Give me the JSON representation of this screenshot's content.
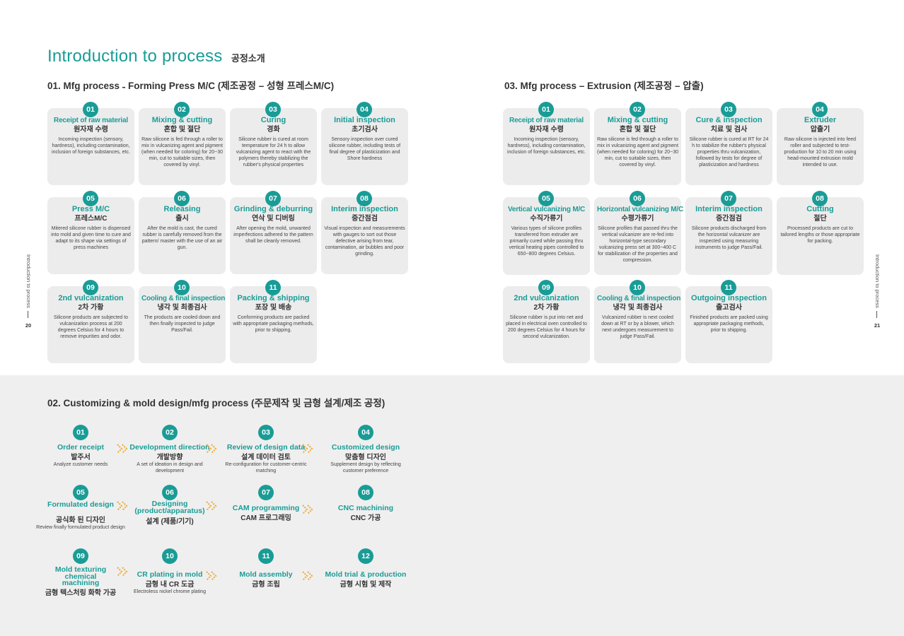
{
  "page_title": {
    "en": "Introduction to process",
    "ko": "공정소개"
  },
  "side_label": "Introduction to process",
  "page_numbers": {
    "left": "20",
    "right": "21"
  },
  "sections": {
    "forming": "01. Mfg process  ˗  Forming Press M/C  (제조공정 – 성형 프레스M/C)",
    "extrusion": "03. Mfg process – Extrusion  (제조공정 – 압출)",
    "custom": "02. Customizing & mold design/mfg process (주문제작 및 금형 설계/제조 공정)"
  },
  "forming_steps": [
    {
      "num": "01",
      "en": "Receipt of raw material",
      "ko": "원자재 수령",
      "desc": "Incoming inspection (sensory, hardness), including contamination, inclusion of foreign substances, etc."
    },
    {
      "num": "02",
      "en": "Mixing & cutting",
      "ko": "혼합 및 절단",
      "desc": "Raw silicone is fed through a roller to mix in vulcanizing agent and pigment (when needed for coloring) for 20~30 min, cut to suitable sizes, then covered by vinyl."
    },
    {
      "num": "03",
      "en": "Curing",
      "ko": "경화",
      "desc": "Silicone rubber is cured at room temperature for 24 h to allow vulcanizing agent to react with the polymers thereby stabilizing the rubber's physical properties"
    },
    {
      "num": "04",
      "en": "Initial inspection",
      "ko": "초기검사",
      "desc": "Sensory inspection over cured silicone rubber, including tests of final degree of plasticization and Shore hardness"
    },
    {
      "num": "05",
      "en": "Press M/C",
      "ko": "프레스M/C",
      "desc": "Mitered silicone rubber is dispensed into mold and given time to cure and adapt to its shape via settings of press machines"
    },
    {
      "num": "06",
      "en": "Releasing",
      "ko": "출시",
      "desc": "After the mold is cast, the cured rubber is carefully removed from the pattern/ master with the use of an air gun."
    },
    {
      "num": "07",
      "en": "Grinding & deburring",
      "ko": "연삭 및 디버링",
      "desc": "After opening the mold, unwanted imperfections adhered to the pattern shall be cleanly removed."
    },
    {
      "num": "08",
      "en": "Interim inspection",
      "ko": "중간점검",
      "desc": "Visual inspection and measurements with gauges to sort out those defective arising from tear, contamination, air bubbles and poor grinding."
    },
    {
      "num": "09",
      "en": "2nd vulcanization",
      "ko": "2차 가황",
      "desc": "Silicone products are subjected to vulcanization process at 200 degrees Celsius for 4 hours to remove impurities and odor."
    },
    {
      "num": "10",
      "en": "Cooling & final inspection",
      "ko": "냉각 및 최종검사",
      "desc": "The products are cooled down and then finally inspected to judge Pass/Fail."
    },
    {
      "num": "11",
      "en": "Packing & shipping",
      "ko": "포장 및 배송",
      "desc": "Conforming products are packed with appropriate packaging methods, prior to shipping."
    }
  ],
  "extrusion_steps": [
    {
      "num": "01",
      "en": "Receipt of raw material",
      "ko": "원자재 수령",
      "desc": "Incoming inspection (sensory, hardness), including contamination, inclusion of foreign substances, etc."
    },
    {
      "num": "02",
      "en": "Mixing & cutting",
      "ko": "혼합 및 절단",
      "desc": "Raw silicone is fed through a roller to mix in vulcanizing agent and pigment (when needed for coloring) for 20~30 min, cut to suitable sizes, then covered by vinyl."
    },
    {
      "num": "03",
      "en": "Cure & inspection",
      "ko": "치료 및 검사",
      "desc": "Silicone rubber is cured at RT for 24 h to stabilize the rubber's physical properties thru vulcanization, followed by tests for degree of plasticization and hardness"
    },
    {
      "num": "04",
      "en": "Extruder",
      "ko": "압출기",
      "desc": "Raw silicone is injected into feed roller and subjected to test-production for 10 to 20 min using head-mounted extrusion mold intended to use."
    },
    {
      "num": "05",
      "en": "Vertical vulcanizing M/C",
      "ko": "수직가류기",
      "desc": "Various types of silicone profiles transferred from extruder are primarily cured while passing thru vertical heating pipes controlled to 650~800 degrees Celsius."
    },
    {
      "num": "06",
      "en": "Horizontal vulcanizing M/C",
      "ko": "수평가류기",
      "desc": "Silicone profiles that passed thru the vertical vulcanizer are re-fed into horizontal-type secondary vulcanizing press set at 300~400 C for stabilization of the properties and compression."
    },
    {
      "num": "07",
      "en": "Interim inspection",
      "ko": "중간점검",
      "desc": "Silicone products discharged from the horizontal vulcanizer are inspected using measuring instruments to judge Pass/Fail."
    },
    {
      "num": "08",
      "en": "Cutting",
      "ko": "절단",
      "desc": "Processed products are cut to tailored lengths or those appropriate for packing."
    },
    {
      "num": "09",
      "en": "2nd vulcanization",
      "ko": "2차 가황",
      "desc": "Silicone rubber is put into net and placed in electrical oven controlled to 200 degrees Celsius for 4 hours for second vulcanization."
    },
    {
      "num": "10",
      "en": "Cooling & final inspection",
      "ko": "냉각 및 최종검사",
      "desc": "Vulcanized rubber is next cooled down at RT or by a blower, which next undergoes measurement to judge Pass/Fail."
    },
    {
      "num": "11",
      "en": "Outgoing inspection",
      "ko": "출고검사",
      "desc": "Finished products are packed using appropriate packaging methods, prior to shipping."
    }
  ],
  "custom_steps": [
    {
      "num": "01",
      "en": "Order receipt",
      "ko": "발주서",
      "desc": "Analyze customer needs"
    },
    {
      "num": "02",
      "en": "Development direction",
      "ko": "개발방향",
      "desc": "A set of ideation in design and development"
    },
    {
      "num": "03",
      "en": "Review of design data",
      "ko": "설계 데이터 검토",
      "desc": "Re-configuration for customer-centric matching"
    },
    {
      "num": "04",
      "en": "Customized design",
      "ko": "맞춤형 디자인",
      "desc": "Supplement design by reflecting customer preference"
    },
    {
      "num": "05",
      "en": "Formulated design",
      "ko": "공식화 된 디자인",
      "desc": "Review finally formulated product design"
    },
    {
      "num": "06",
      "en": "Designing (product/apparatus)",
      "ko": "설계 (제품/기기)",
      "desc": ""
    },
    {
      "num": "07",
      "en": "CAM programming",
      "ko": "CAM 프로그래밍",
      "desc": ""
    },
    {
      "num": "08",
      "en": "CNC machining",
      "ko": "CNC 가공",
      "desc": ""
    },
    {
      "num": "09",
      "en": "Mold texturing chemical machining",
      "ko": "금형 텍스처링 화학 가공",
      "desc": ""
    },
    {
      "num": "10",
      "en": "CR plating in mold",
      "ko": "금형 내 CR 도금",
      "desc": "Electroless nickel chrome plating"
    },
    {
      "num": "11",
      "en": "Mold assembly",
      "ko": "금형 조립",
      "desc": ""
    },
    {
      "num": "12",
      "en": "Mold trial & production",
      "ko": "금형 시험 및 제작",
      "desc": ""
    }
  ],
  "colors": {
    "accent": "#1a9c96",
    "arrow": "#f0a830",
    "card_bg": "#ececec",
    "band_bg": "#efefef"
  },
  "icons": {
    "flow_arrow": "double-chevron-right-icon"
  }
}
